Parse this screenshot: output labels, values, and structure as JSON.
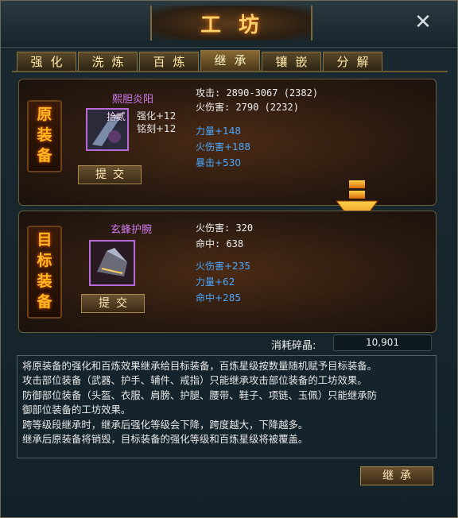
{
  "window": {
    "title": "工坊"
  },
  "tabs": [
    {
      "label": "强化"
    },
    {
      "label": "洗炼"
    },
    {
      "label": "百炼"
    },
    {
      "label": "继承",
      "active": true
    },
    {
      "label": "镶嵌"
    },
    {
      "label": "分解"
    }
  ],
  "source": {
    "side_label": [
      "原",
      "装",
      "备"
    ],
    "item_name": "熙胆炎阳",
    "icon_tag": "拾贰",
    "enhance": "强化+12",
    "engrave": "铭刻+12",
    "submit_label": "提交",
    "stats": [
      "攻击: 2890-3067 (2382)",
      "火伤害: 2790 (2232)"
    ],
    "bonus": [
      "力量+148",
      "火伤害+188",
      "暴击+530"
    ]
  },
  "target": {
    "side_label": [
      "目",
      "标",
      "装",
      "备"
    ],
    "item_name": "玄蜂护腕",
    "submit_label": "提交",
    "stats": [
      "火伤害: 320",
      "命中: 638"
    ],
    "bonus": [
      "火伤害+235",
      "力量+62",
      "命中+285"
    ]
  },
  "cost": {
    "label": "消耗碎晶:",
    "value": "10,901"
  },
  "description": [
    "将原装备的强化和百炼效果继承给目标装备，百炼星级按数量随机赋予目标装备。",
    "攻击部位装备（武器、护手、辅件、戒指）只能继承攻击部位装备的工坊效果。",
    "防御部位装备（头盔、衣服、肩膀、护腿、腰带、鞋子、项链、玉佩）只能继承防",
    "御部位装备的工坊效果。",
    "跨等级段继承时，继承后强化等级会下降，跨度越大，下降越多。",
    "继承后原装备将销毁，目标装备的强化等级和百炼星级将被覆盖。"
  ],
  "inherit_button": "继承",
  "colors": {
    "accent": "#ffb820",
    "bonus_blue": "#4aa8ff",
    "item_purple": "#d27cf0"
  }
}
